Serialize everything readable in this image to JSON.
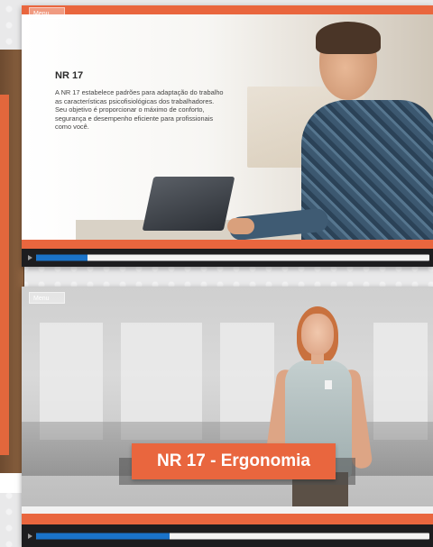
{
  "top_slide": {
    "menu_label": "Menu",
    "title": "NR 17",
    "body": "A NR 17 estabelece padrões para adaptação do trabalho as características psicofisiológicas dos trabalhadores. Seu objetivo é proporcionar o máximo de conforto, segurança e desempenho eficiente para profissionais como você.",
    "progress": 0.13
  },
  "bottom_slide": {
    "menu_label": "Menu",
    "title_badge": "NR 17 - Ergonomia",
    "progress": 0.34
  },
  "colors": {
    "accent_orange": "#e9663e",
    "progress_blue": "#1a73c9",
    "player_bg": "#1d1d1f"
  }
}
